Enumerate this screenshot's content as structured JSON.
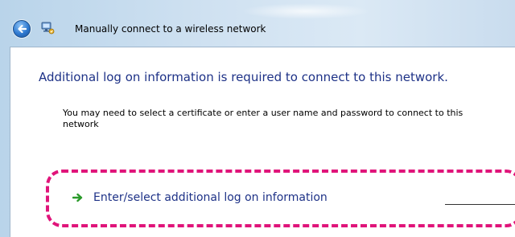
{
  "window": {
    "title": "Manually connect to a wireless network"
  },
  "main": {
    "heading": "Additional log on information is required to connect to this network.",
    "description": "You may need to select a certificate or enter a user name and password to connect to this network",
    "command_link": {
      "label": "Enter/select additional log on information",
      "icon": "green-arrow-icon"
    }
  },
  "icons": {
    "back": "back-arrow-icon",
    "network": "network-icon"
  },
  "colors": {
    "heading": "#1e3287",
    "link": "#1e3287",
    "highlight": "#e0147a",
    "arrow": "#2a9a2a"
  }
}
